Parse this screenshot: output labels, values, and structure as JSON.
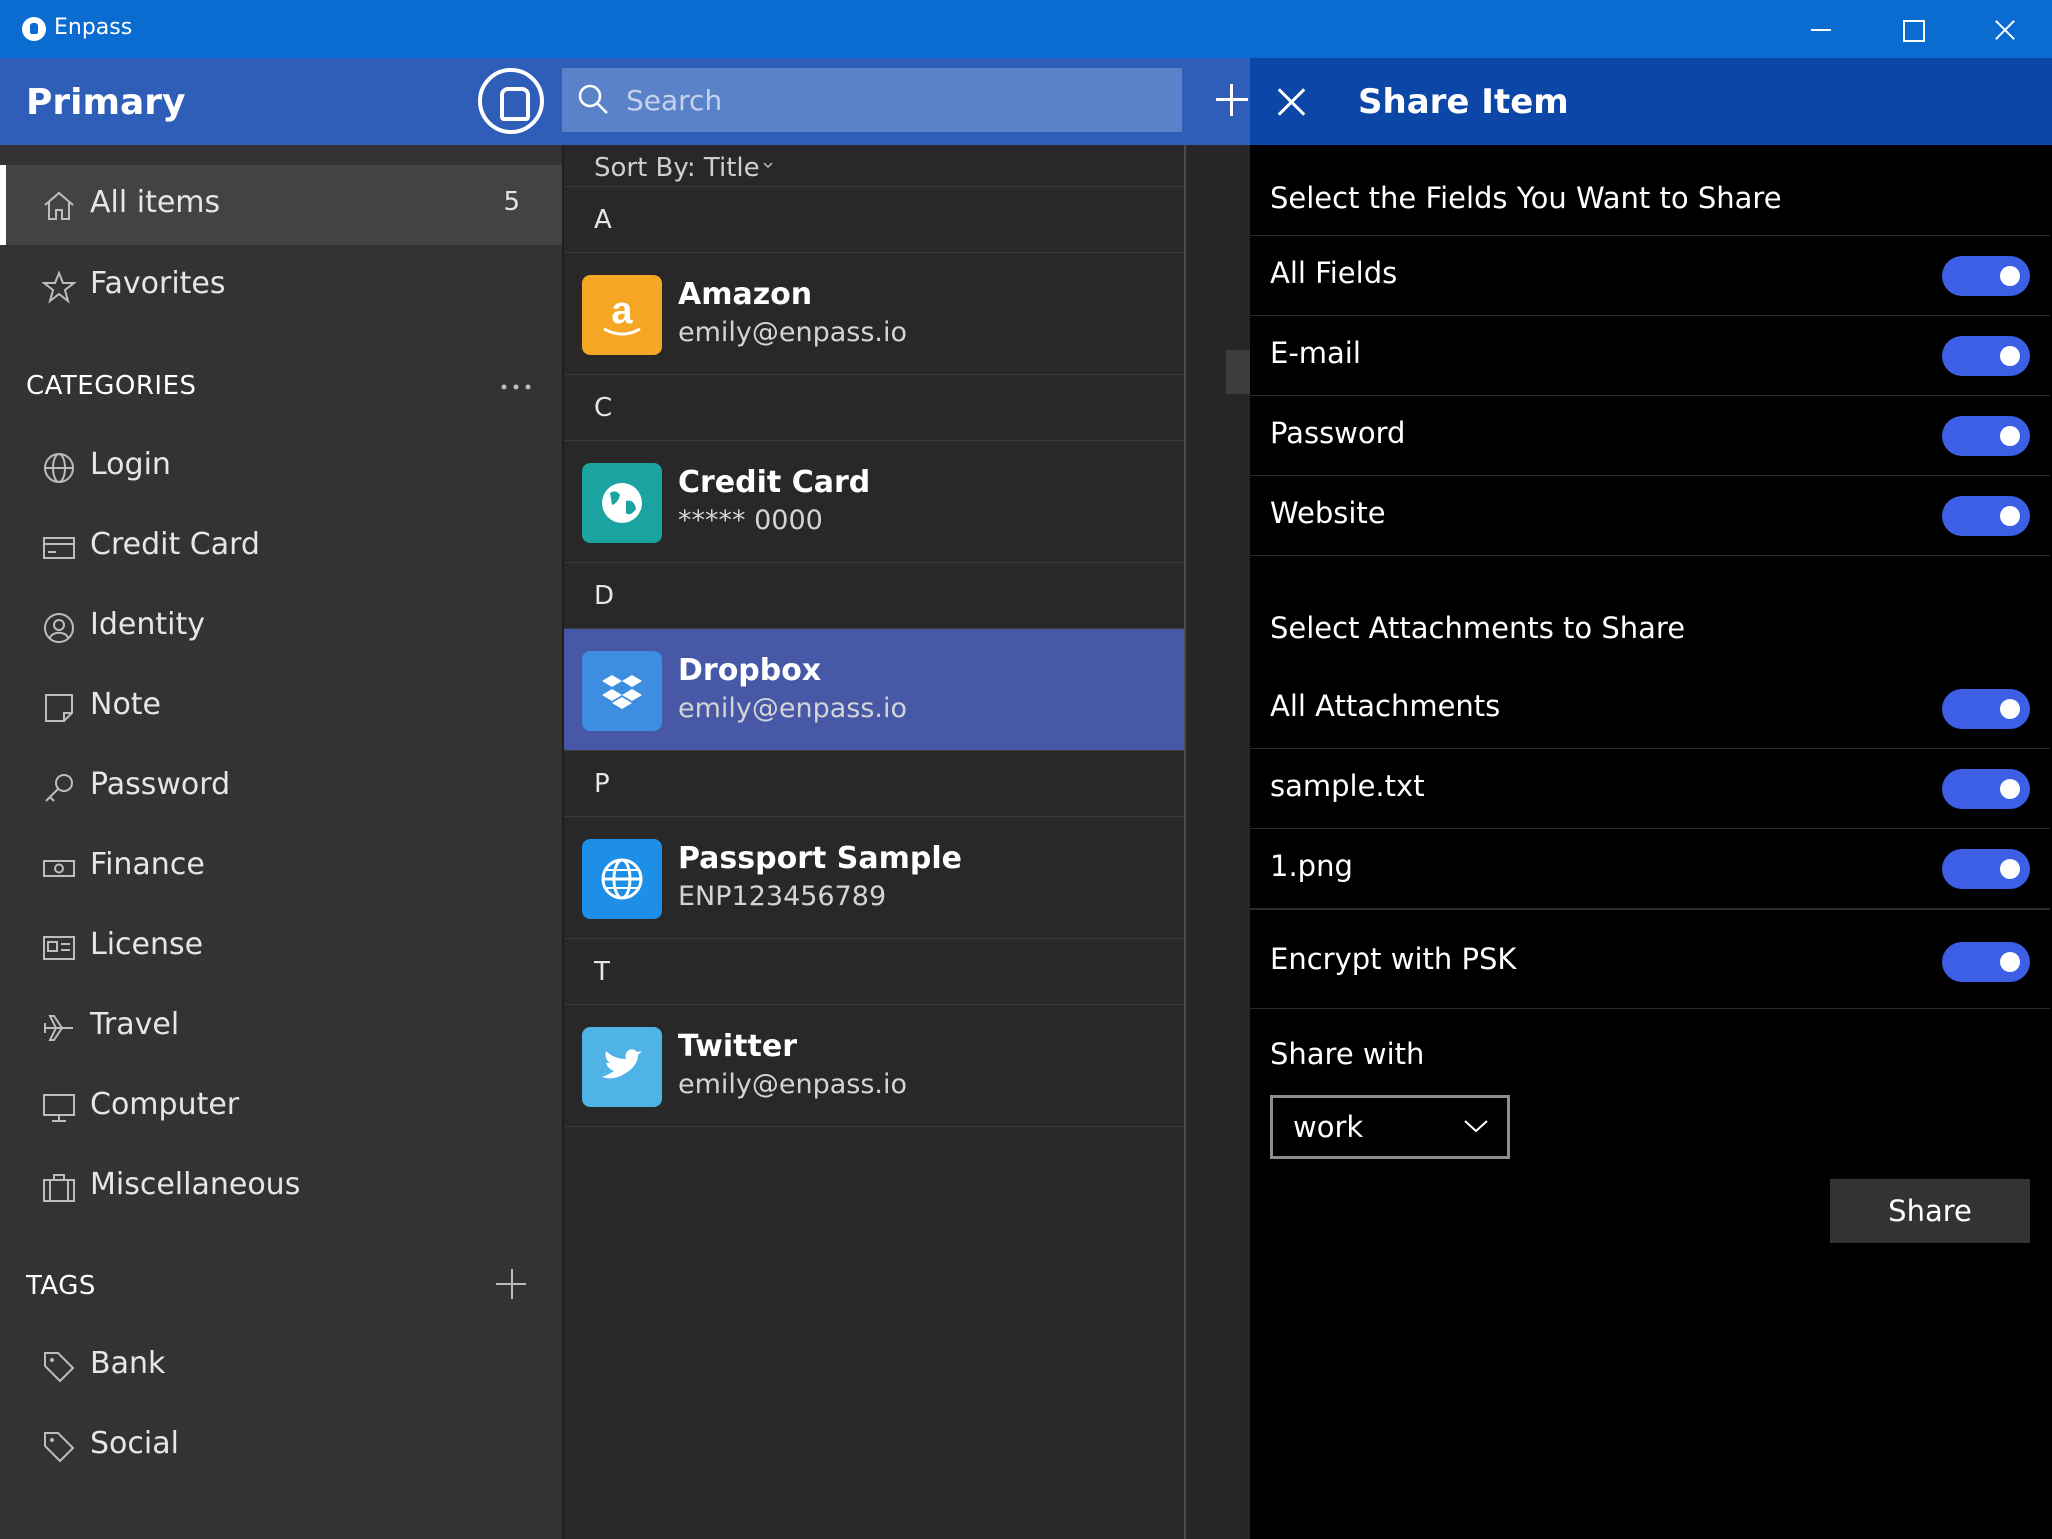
{
  "window": {
    "title": "Enpass"
  },
  "header": {
    "vault_name": "Primary",
    "search_placeholder": "Search",
    "pane_title": "Share Item"
  },
  "sidebar": {
    "all_items": {
      "label": "All items",
      "count": "5",
      "icon": "home-icon"
    },
    "favorites": {
      "label": "Favorites",
      "icon": "star-icon"
    },
    "categories_heading": "CATEGORIES",
    "categories": [
      {
        "label": "Login",
        "icon": "globe-icon"
      },
      {
        "label": "Credit Card",
        "icon": "credit-card-icon"
      },
      {
        "label": "Identity",
        "icon": "identity-icon"
      },
      {
        "label": "Note",
        "icon": "note-icon"
      },
      {
        "label": "Password",
        "icon": "key-icon"
      },
      {
        "label": "Finance",
        "icon": "banknote-icon"
      },
      {
        "label": "License",
        "icon": "license-icon"
      },
      {
        "label": "Travel",
        "icon": "airplane-icon"
      },
      {
        "label": "Computer",
        "icon": "monitor-icon"
      },
      {
        "label": "Miscellaneous",
        "icon": "briefcase-icon"
      }
    ],
    "tags_heading": "TAGS",
    "tags": [
      {
        "label": "Bank",
        "icon": "tag-icon"
      },
      {
        "label": "Social",
        "icon": "tag-icon"
      }
    ]
  },
  "list": {
    "sort_label": "Sort By: Title",
    "groups": [
      {
        "letter": "A",
        "items": [
          {
            "title": "Amazon",
            "subtitle": "emily@enpass.io",
            "icon": "amazon-icon",
            "color": "#f5a623"
          }
        ]
      },
      {
        "letter": "C",
        "items": [
          {
            "title": "Credit Card",
            "subtitle": "***** 0000",
            "icon": "globe-icon",
            "color": "#1aa3a0"
          }
        ]
      },
      {
        "letter": "D",
        "items": [
          {
            "title": "Dropbox",
            "subtitle": "emily@enpass.io",
            "icon": "dropbox-icon",
            "color": "#3d8ee0",
            "selected": true
          }
        ]
      },
      {
        "letter": "P",
        "items": [
          {
            "title": "Passport Sample",
            "subtitle": "ENP123456789",
            "icon": "globe-icon",
            "color": "#1e8fe6"
          }
        ]
      },
      {
        "letter": "T",
        "items": [
          {
            "title": "Twitter",
            "subtitle": "emily@enpass.io",
            "icon": "twitter-icon",
            "color": "#4fb3e8"
          }
        ]
      }
    ]
  },
  "share": {
    "fields_heading": "Select the Fields You Want to Share",
    "fields": [
      {
        "label": "All Fields",
        "on": true
      },
      {
        "label": "E-mail",
        "on": true
      },
      {
        "label": "Password",
        "on": true
      },
      {
        "label": "Website",
        "on": true
      }
    ],
    "attachments_heading": "Select Attachments to Share",
    "attachments": [
      {
        "label": "All Attachments",
        "on": true
      },
      {
        "label": "sample.txt",
        "on": true
      },
      {
        "label": "1.png",
        "on": true
      }
    ],
    "encrypt": {
      "label": "Encrypt with PSK",
      "on": true
    },
    "share_with_label": "Share with",
    "share_with_value": "work",
    "share_button": "Share"
  },
  "colors": {
    "titlebar": "#0a6bd1",
    "header": "#2e5eb8",
    "share_header": "#0c47a8",
    "selected_row": "#4658a6",
    "toggle_on": "#3c5fe6"
  }
}
